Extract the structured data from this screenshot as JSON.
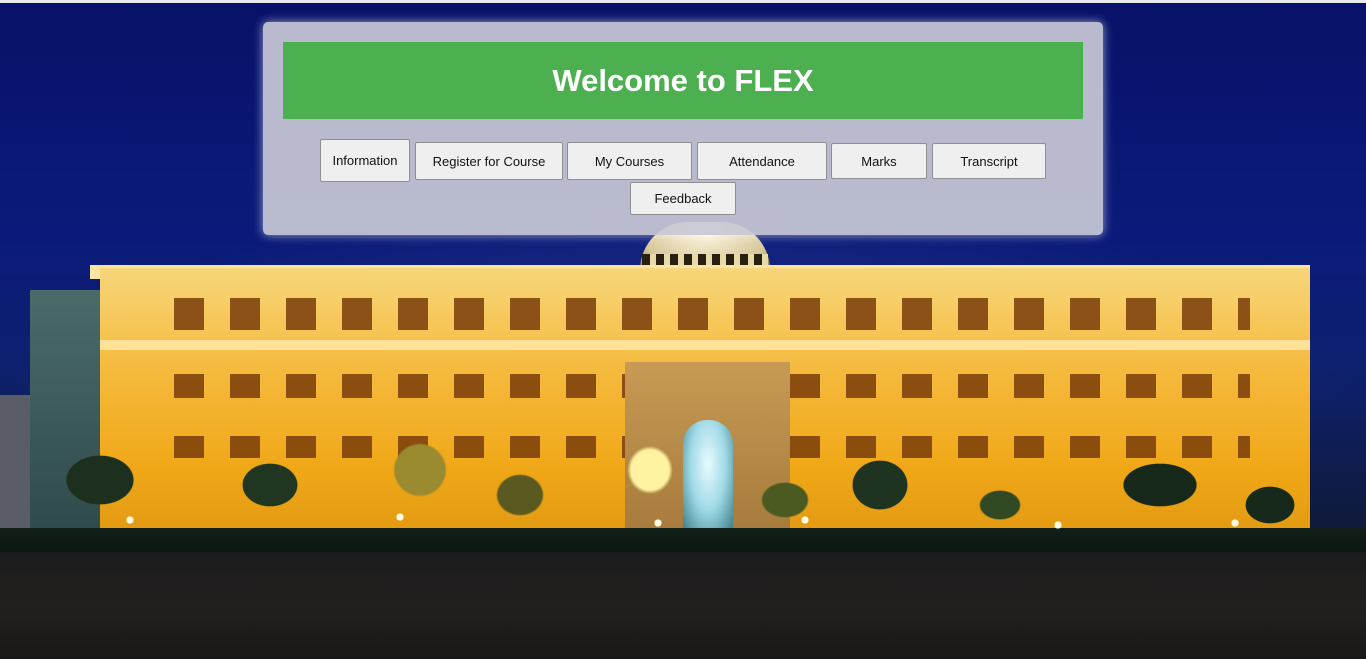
{
  "page": {
    "title": "Welcome to FLEX"
  },
  "nav": {
    "items": [
      {
        "label": "Information"
      },
      {
        "label": "Register for Course"
      },
      {
        "label": "My Courses"
      },
      {
        "label": "Attendance"
      },
      {
        "label": "Marks"
      },
      {
        "label": "Transcript"
      },
      {
        "label": "Feedback"
      }
    ]
  },
  "colors": {
    "banner": "#4caf50",
    "panel": "#c9c9d6",
    "button": "#efefef"
  }
}
